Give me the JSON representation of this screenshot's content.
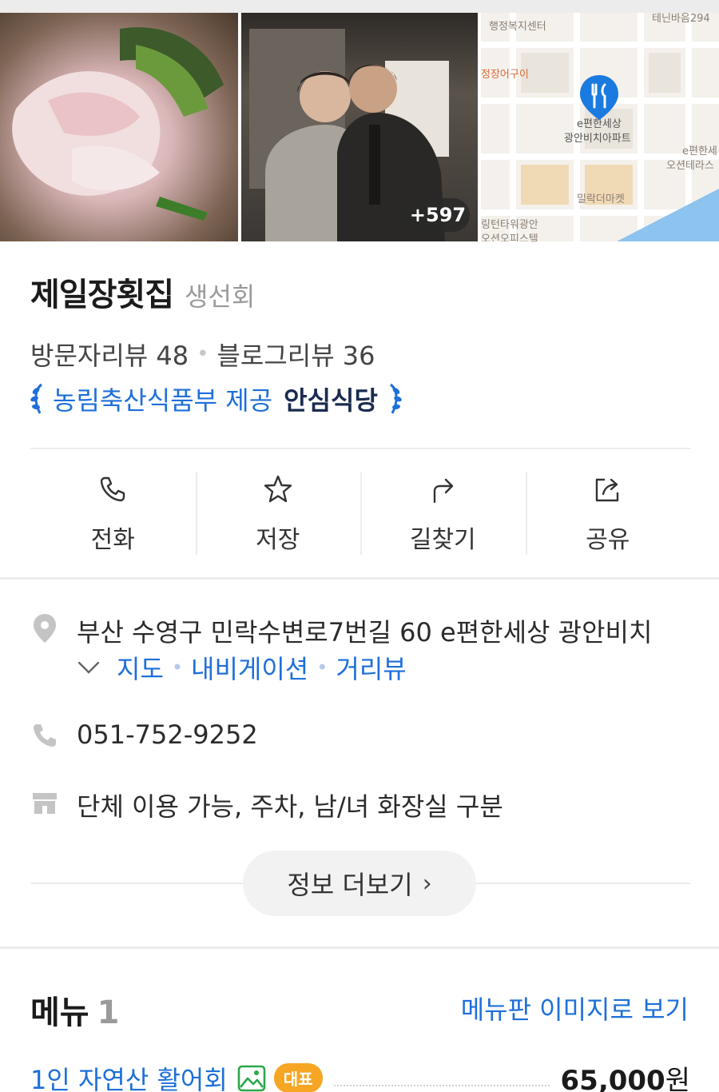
{
  "photos": {
    "more_count": "+597",
    "map_labels": [
      "행정복지센터",
      "정장어구이",
      "e편한세상",
      "광안비치아파트",
      "밀락더마켓",
      "e편한세",
      "오션테라스",
      "테닌바음294",
      "링턴타워광안",
      "오션오피스텔"
    ]
  },
  "place": {
    "name": "제일장횟집",
    "category": "생선회",
    "visitor_review_label": "방문자리뷰 48",
    "blog_review_label": "블로그리뷰 36",
    "badge_text": "농림축산식품부 제공",
    "badge_strong": "안심식당"
  },
  "actions": [
    {
      "label": "전화",
      "icon": "phone-icon"
    },
    {
      "label": "저장",
      "icon": "star-icon"
    },
    {
      "label": "길찾기",
      "icon": "directions-icon"
    },
    {
      "label": "공유",
      "icon": "share-icon"
    }
  ],
  "info": {
    "address": "부산 수영구 민락수변로7번길 60 e편한세상 광안비치",
    "links": [
      "지도",
      "내비게이션",
      "거리뷰"
    ],
    "phone": "051-752-9252",
    "amenities": "단체 이용 가능, 주차, 남/녀 화장실 구분",
    "more_label": "정보 더보기"
  },
  "menu": {
    "title": "메뉴",
    "count": "1",
    "image_link": "메뉴판 이미지로 보기",
    "items": [
      {
        "name": "1인 자연산 활어회",
        "badge": "대표",
        "price": "65,000",
        "unit": "원"
      }
    ]
  },
  "colors": {
    "link_blue": "#1e6fd9",
    "badge_orange": "#f6a623",
    "map_pin_blue": "#1a7ae0"
  }
}
